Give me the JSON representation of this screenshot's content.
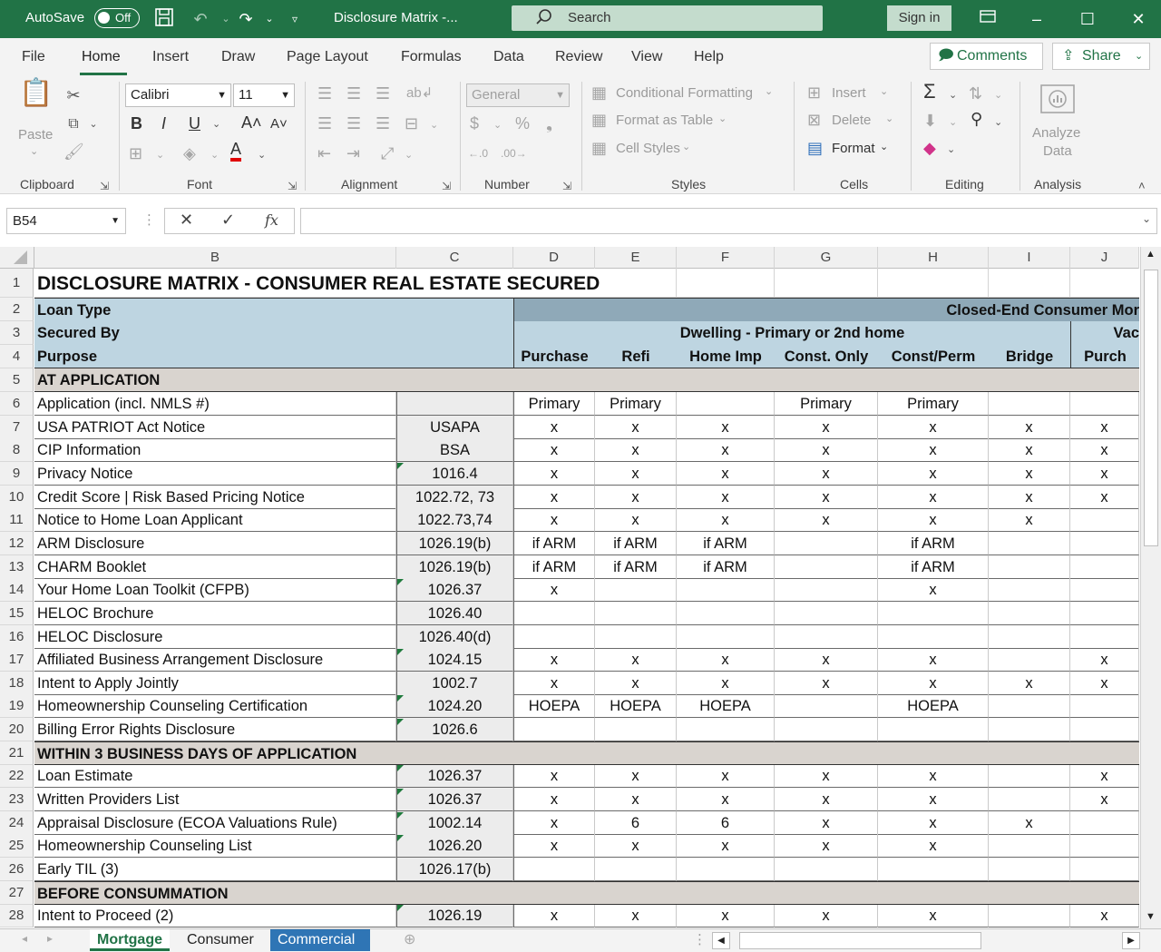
{
  "titlebar": {
    "autosave_label": "AutoSave",
    "autosave_state": "Off",
    "doc_title": "Disclosure Matrix  -...",
    "search_placeholder": "Search",
    "signin_label": "Sign in"
  },
  "menu": {
    "tabs": [
      "File",
      "Home",
      "Insert",
      "Draw",
      "Page Layout",
      "Formulas",
      "Data",
      "Review",
      "View",
      "Help"
    ],
    "active_tab": "Home",
    "comments_label": "Comments",
    "share_label": "Share"
  },
  "ribbon": {
    "clipboard": {
      "paste_label": "Paste",
      "group_label": "Clipboard"
    },
    "font": {
      "font_name": "Calibri",
      "font_size": "11",
      "bold": "B",
      "italic": "I",
      "underline": "U",
      "group_label": "Font"
    },
    "alignment": {
      "group_label": "Alignment"
    },
    "number": {
      "format": "General",
      "group_label": "Number"
    },
    "styles": {
      "conditional_formatting": "Conditional Formatting",
      "format_as_table": "Format as Table",
      "cell_styles": "Cell Styles",
      "group_label": "Styles"
    },
    "cells": {
      "insert": "Insert",
      "delete": "Delete",
      "format": "Format",
      "group_label": "Cells"
    },
    "editing": {
      "group_label": "Editing"
    },
    "analysis": {
      "analyze_data_line1": "Analyze",
      "analyze_data_line2": "Data",
      "group_label": "Analysis"
    }
  },
  "formula_bar": {
    "name_box": "B54",
    "formula": ""
  },
  "columns": [
    "B",
    "C",
    "D",
    "E",
    "F",
    "G",
    "H",
    "I",
    "J"
  ],
  "sheet": {
    "title": "DISCLOSURE MATRIX - CONSUMER REAL ESTATE SECURED",
    "header_rows": {
      "row2_label": "Loan Type",
      "row2_right": "Closed-End Consumer Mor",
      "row3_label": "Secured By",
      "row3_mid": "Dwelling - Primary or 2nd home",
      "row3_j": "Vac",
      "row4_label": "Purpose",
      "row4_cols": [
        "Purchase",
        "Refi",
        "Home Imp",
        "Const. Only",
        "Const/Perm",
        "Bridge",
        "Purch"
      ]
    },
    "sections": {
      "r5": "AT APPLICATION",
      "r21": "WITHIN 3 BUSINESS DAYS OF APPLICATION",
      "r27": "BEFORE CONSUMMATION"
    },
    "rows": [
      {
        "n": "6",
        "b": "Application (incl. NMLS #)",
        "c": "",
        "d": "Primary",
        "e": "Primary",
        "f": "",
        "g": "Primary",
        "h": "Primary",
        "i": "",
        "j": ""
      },
      {
        "n": "7",
        "b": "USA PATRIOT Act Notice",
        "c": "USAPA",
        "d": "x",
        "e": "x",
        "f": "x",
        "g": "x",
        "h": "x",
        "i": "x",
        "j": "x"
      },
      {
        "n": "8",
        "b": "CIP Information",
        "c": "BSA",
        "d": "x",
        "e": "x",
        "f": "x",
        "g": "x",
        "h": "x",
        "i": "x",
        "j": "x"
      },
      {
        "n": "9",
        "b": "Privacy Notice",
        "c": "1016.4",
        "d": "x",
        "e": "x",
        "f": "x",
        "g": "x",
        "h": "x",
        "i": "x",
        "j": "x"
      },
      {
        "n": "10",
        "b": "Credit Score  | Risk Based Pricing Notice",
        "c": "1022.72, 73",
        "d": "x",
        "e": "x",
        "f": "x",
        "g": "x",
        "h": "x",
        "i": "x",
        "j": "x"
      },
      {
        "n": "11",
        "b": "Notice to Home Loan Applicant",
        "c": "1022.73,74",
        "d": "x",
        "e": "x",
        "f": "x",
        "g": "x",
        "h": "x",
        "i": "x",
        "j": ""
      },
      {
        "n": "12",
        "b": "ARM Disclosure",
        "c": "1026.19(b)",
        "d": "if ARM",
        "e": "if ARM",
        "f": "if ARM",
        "g": "",
        "h": "if ARM",
        "i": "",
        "j": ""
      },
      {
        "n": "13",
        "b": "CHARM Booklet",
        "c": "1026.19(b)",
        "d": "if ARM",
        "e": "if ARM",
        "f": "if ARM",
        "g": "",
        "h": "if ARM",
        "i": "",
        "j": ""
      },
      {
        "n": "14",
        "b": "Your Home Loan Toolkit (CFPB)",
        "c": "1026.37",
        "d": "x",
        "e": "",
        "f": "",
        "g": "",
        "h": "x",
        "i": "",
        "j": ""
      },
      {
        "n": "15",
        "b": "HELOC Brochure",
        "c": "1026.40",
        "d": "",
        "e": "",
        "f": "",
        "g": "",
        "h": "",
        "i": "",
        "j": ""
      },
      {
        "n": "16",
        "b": "HELOC Disclosure",
        "c": "1026.40(d)",
        "d": "",
        "e": "",
        "f": "",
        "g": "",
        "h": "",
        "i": "",
        "j": ""
      },
      {
        "n": "17",
        "b": "Affiliated Business Arrangement Disclosure",
        "c": "1024.15",
        "d": "x",
        "e": "x",
        "f": "x",
        "g": "x",
        "h": "x",
        "i": "",
        "j": "x"
      },
      {
        "n": "18",
        "b": "Intent to Apply Jointly",
        "c": "1002.7",
        "d": "x",
        "e": "x",
        "f": "x",
        "g": "x",
        "h": "x",
        "i": "x",
        "j": "x"
      },
      {
        "n": "19",
        "b": "Homeownership Counseling Certification",
        "c": "1024.20",
        "d": "HOEPA",
        "e": "HOEPA",
        "f": "HOEPA",
        "g": "",
        "h": "HOEPA",
        "i": "",
        "j": ""
      },
      {
        "n": "20",
        "b": "Billing Error Rights Disclosure",
        "c": "1026.6",
        "d": "",
        "e": "",
        "f": "",
        "g": "",
        "h": "",
        "i": "",
        "j": ""
      },
      {
        "n": "22",
        "b": "Loan Estimate",
        "c": "1026.37",
        "d": "x",
        "e": "x",
        "f": "x",
        "g": "x",
        "h": "x",
        "i": "",
        "j": "x"
      },
      {
        "n": "23",
        "b": "Written Providers List",
        "c": "1026.37",
        "d": "x",
        "e": "x",
        "f": "x",
        "g": "x",
        "h": "x",
        "i": "",
        "j": "x"
      },
      {
        "n": "24",
        "b": "Appraisal Disclosure  (ECOA Valuations Rule)",
        "c": "1002.14",
        "d": "x",
        "e": "6",
        "f": "6",
        "g": "x",
        "h": "x",
        "i": "x",
        "j": ""
      },
      {
        "n": "25",
        "b": "Homeownership Counseling List",
        "c": "1026.20",
        "d": "x",
        "e": "x",
        "f": "x",
        "g": "x",
        "h": "x",
        "i": "",
        "j": ""
      },
      {
        "n": "26",
        "b": "Early TIL (3)",
        "c": "1026.17(b)",
        "d": "",
        "e": "",
        "f": "",
        "g": "",
        "h": "",
        "i": "",
        "j": ""
      },
      {
        "n": "28",
        "b": "Intent to Proceed  (2)",
        "c": "1026.19",
        "d": "x",
        "e": "x",
        "f": "x",
        "g": "x",
        "h": "x",
        "i": "",
        "j": "x"
      }
    ]
  },
  "sheet_tabs": [
    "Mortgage",
    "Consumer",
    "Commercial"
  ],
  "active_sheet": "Mortgage",
  "colors": {
    "excel_green": "#217346",
    "header_fill": "#8fa9b8",
    "subheader_fill": "#bed5e1",
    "section_fill": "#d9d4cf",
    "commercial_tab": "#2f75b5"
  }
}
